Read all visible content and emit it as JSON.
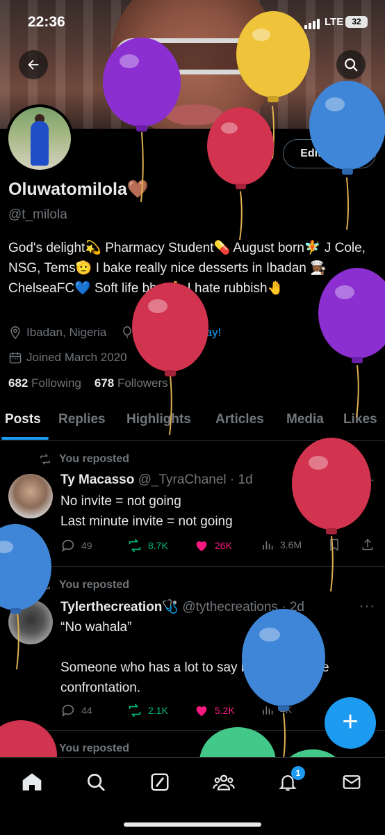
{
  "status_bar": {
    "time": "22:36",
    "network": "LTE",
    "battery": "32"
  },
  "profile": {
    "name": "Oluwatomilola🤎",
    "handle": "@t_milola",
    "edit_button": "Edit profile",
    "bio": "God's delight💫 Pharmacy Student💊 August born🧚 J Cole, NSG, Tems🫡 I bake really nice desserts in Ibadan 👩🏾‍🍳 ChelseaFC💙 Soft life bby 🙏 I hate rubbish🤚",
    "location": "Ibadan, Nigeria",
    "birthday": "Happy birthday!",
    "joined": "Joined March 2020",
    "following_count": "682",
    "following_label": "Following",
    "followers_count": "678",
    "followers_label": "Followers"
  },
  "tabs": [
    "Posts",
    "Replies",
    "Highlights",
    "Articles",
    "Media",
    "Likes"
  ],
  "posts": [
    {
      "repost_label": "You reposted",
      "author_name": "Ty Macasso",
      "author_handle": "@_TyraChanel",
      "time": "· 1d",
      "text": "No invite = not going\nLast minute invite = not going",
      "replies": "49",
      "reposts": "8.7K",
      "likes": "26K",
      "views": "3.6M"
    },
    {
      "repost_label": "You reposted",
      "author_name": "Tylerthecreation🩺",
      "author_handle": "@tythecreations",
      "time": "· 2d",
      "text": "“No wahala”\n\nSomeone who has a lot to say but doesn’t like confrontation.",
      "replies": "44",
      "reposts": "2.1K",
      "likes": "5.2K",
      "views": "4K"
    },
    {
      "repost_label": "You reposted"
    }
  ],
  "fab": "+",
  "notifications_badge": "1",
  "colors": {
    "accent": "#1d9bf0",
    "repost": "#00ba7c",
    "like": "#f91880",
    "muted": "#71767b",
    "text": "#e7e9ea"
  },
  "icons": [
    "back-arrow-icon",
    "search-icon",
    "location-icon",
    "balloon-icon",
    "calendar-icon",
    "repost-icon",
    "reply-icon",
    "heart-icon",
    "views-icon",
    "bookmark-icon",
    "share-icon",
    "home-icon",
    "grok-icon",
    "communities-icon",
    "bell-icon",
    "mail-icon",
    "plus-icon"
  ]
}
